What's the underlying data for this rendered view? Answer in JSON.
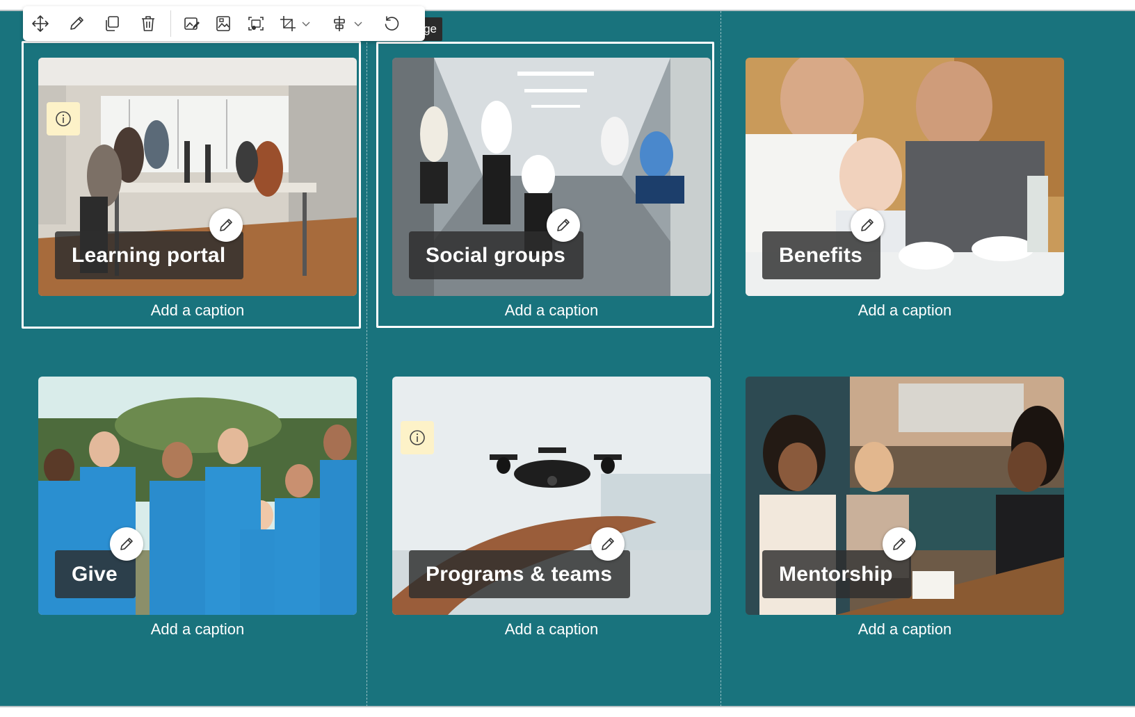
{
  "toolbar": {
    "buttons": [
      {
        "name": "move-icon"
      },
      {
        "name": "edit-icon"
      },
      {
        "name": "duplicate-icon"
      },
      {
        "name": "delete-icon"
      },
      {
        "name": "edit-image-icon"
      },
      {
        "name": "change-image-icon"
      },
      {
        "name": "image-focus-icon"
      },
      {
        "name": "crop-icon"
      },
      {
        "name": "align-icon"
      },
      {
        "name": "reset-icon"
      }
    ],
    "tooltip_text": "ge"
  },
  "tiles": [
    {
      "title": "Learning portal",
      "caption": "Add a caption"
    },
    {
      "title": "Social groups",
      "caption": "Add a caption"
    },
    {
      "title": "Benefits",
      "caption": "Add a caption"
    },
    {
      "title": "Give",
      "caption": "Add a caption"
    },
    {
      "title": "Programs & teams",
      "caption": "Add a caption"
    },
    {
      "title": "Mentorship",
      "caption": "Add a caption"
    }
  ],
  "colors": {
    "canvas": "#19737d",
    "title_box": "#2d2d2d",
    "info_badge": "#fdf2c8",
    "caption_text": "#ffffff"
  }
}
